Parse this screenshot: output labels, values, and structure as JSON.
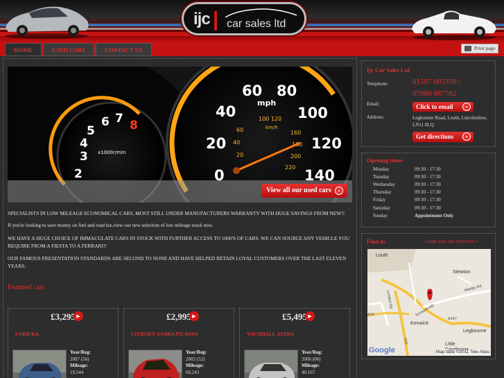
{
  "header": {
    "logo_ijc": "ijc",
    "logo_tagline": "car sales ltd"
  },
  "nav": {
    "tabs": [
      {
        "label": "HOME",
        "active": true
      },
      {
        "label": "USED CARS",
        "active": false
      },
      {
        "label": "CONTACT US",
        "active": false
      }
    ],
    "print_label": "Print page"
  },
  "hero": {
    "cta_label": "View all our used cars",
    "arrow": "»"
  },
  "intro": {
    "p1": " SPECIALISTS IN LOW MILEAGE ECONOMICAL CARS, MOST STILL UNDER MANUFACTURERS WARRANTY WITH HUGE SAVINGS FROM NEW!!",
    "p2": "If you're looking to save money on fuel and road tax,view our new selection of low mileage stock now.",
    "p3": "WE HAVE A HUGE CHOICE OF IMMACULATE CARS IN STOCK WITH FURTHER ACCESS TO 1000'S OF CARS. WE CAN SOURCE ANY VEHICLE YOU REQUIRE FROM A FIESTA TO A FERRARI!!",
    "p4": "OUR FAMOUS PRESENTATION STANDARDS ARE SECOND TO NONE AND HAVE HELPED RETAIN LOYAL CUSTOMERS OVER THE LAST ELEVEN YEARS."
  },
  "featured": {
    "heading": "Featured cars",
    "cars": [
      {
        "price": "£3,295",
        "name": "FORD KA",
        "year_label": "Year/Reg:",
        "year": "2007 (56)",
        "mileage_label": "Mileage:",
        "mileage": "19,544",
        "color": "#3d5f8a"
      },
      {
        "price": "£2,995",
        "name": "CITROEN XSARA PICASSO",
        "year_label": "Year/Reg:",
        "year": "2003 (52)",
        "mileage_label": "Mileage:",
        "mileage": "60,243",
        "color": "#c02020"
      },
      {
        "price": "£5,495",
        "name": "VAUXHALL ASTRA",
        "year_label": "Year/Reg:",
        "year": "2006 (06)",
        "mileage_label": "Mileage:",
        "mileage": "40,167",
        "color": "#b8b8b8"
      }
    ]
  },
  "contact": {
    "title": "Ijc Car Sales Ltd",
    "telephone_label": "Telephone:",
    "phone1": "01507 605359 /",
    "phone2": "07960 887782",
    "email_label": "Email:",
    "email_cta": "Click to email",
    "address_label": "Address:",
    "address": "Legbourne Road, Louth, Lincolnshire, LN11 8LQ",
    "directions_cta": "Get directions"
  },
  "hours": {
    "title": "Opening times",
    "rows": [
      {
        "day": "Monday",
        "time": "09:30 - 17:30"
      },
      {
        "day": "Tuesday",
        "time": "09:30 - 17:30"
      },
      {
        "day": "Wednesday",
        "time": "09:30 - 17:30"
      },
      {
        "day": "Thursday",
        "time": "09:30 - 17:30"
      },
      {
        "day": "Friday",
        "time": "09:30 - 17:30"
      },
      {
        "day": "Saturday",
        "time": "09:30 - 17:30"
      },
      {
        "day": "Sunday",
        "time": "Appointment Only"
      }
    ]
  },
  "findus": {
    "title": "Find us",
    "large_map_link": "Large map and directions »",
    "map_labels": [
      "Louth",
      "Stewton",
      "Kenwick",
      "Legbourne",
      "Little Cawthorpe",
      "Manby Rd",
      "Kenwick Hill",
      "London Rd",
      "A16",
      "A157",
      "A16"
    ],
    "attribution": "Map data ©2011 Tele Atlas",
    "google": "Google"
  }
}
